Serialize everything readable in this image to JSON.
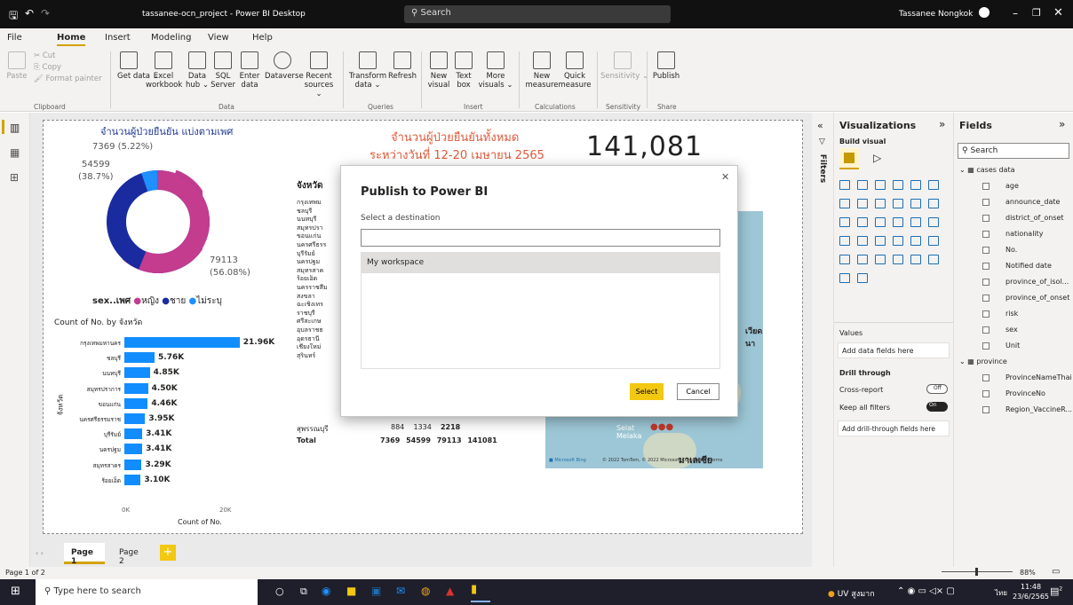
{
  "window": {
    "title": "tassanee-ocn_project - Power BI Desktop",
    "search": "Search",
    "user": "Tassanee Nongkok"
  },
  "tabs": [
    "File",
    "Home",
    "Insert",
    "Modeling",
    "View",
    "Help"
  ],
  "ribbon": {
    "clipboard": {
      "paste": "Paste",
      "cut": "Cut",
      "copy": "Copy",
      "format_painter": "Format painter",
      "group": "Clipboard"
    },
    "data": {
      "items": [
        "Get data ⌄",
        "Excel workbook",
        "Data hub ⌄",
        "SQL Server",
        "Enter data",
        "Dataverse",
        "Recent sources ⌄"
      ],
      "group": "Data"
    },
    "queries": {
      "items": [
        "Transform data ⌄",
        "Refresh"
      ],
      "group": "Queries"
    },
    "insert": {
      "items": [
        "New visual",
        "Text box",
        "More visuals ⌄"
      ],
      "group": "Insert"
    },
    "calculations": {
      "items": [
        "New measure",
        "Quick measure"
      ],
      "group": "Calculations"
    },
    "sensitivity": {
      "items": [
        "Sensitivity ⌄"
      ],
      "group": "Sensitivity"
    },
    "share": {
      "items": [
        "Publish"
      ],
      "group": "Share"
    }
  },
  "report": {
    "donut_title": "จำนวนผู้ป่วยยืนยัน แบ่งตามเพศ",
    "donut_labels": {
      "a": "7369 (5.22%)",
      "b1": "54599",
      "b2": "(38.7%)",
      "c1": "79113",
      "c2": "(56.08%)"
    },
    "donut_legend": {
      "title": "sex..เพศ",
      "items": [
        "หญิง",
        "ชาย",
        "ไม่ระบุ"
      ]
    },
    "headline1": "จำนวนผู้ป่วยยืนยันทั้งหมด",
    "headline2": "ระหว่างวันที่ 12-20 เมษายน 2565",
    "kpi": "141,081",
    "bar_title": "Count of No. by จังหวัด",
    "bar_ylabel": "จังหวัด",
    "bar_xlabel": "Count of No.",
    "bar_ticks": [
      "0K",
      "20K"
    ],
    "table_header": "จังหวัด",
    "table_rows": [
      "กรุงเทพม",
      "ชลบุรี",
      "นนทบุรี",
      "สมุทรปรา",
      "ขอนแก่น",
      "นครศรีธรร",
      "บุรีรัมย์",
      "นครปฐม",
      "สมุทรสาค",
      "ร้อยเอ็ด",
      "นครราชสีม",
      "สงขลา",
      "ฉะเชิงเทร",
      "ราชบุรี",
      "ศรีสะเกษ",
      "อุบลราชธ",
      "อุดรธานี",
      "เชียงใหม่",
      "สุรินทร์",
      "ระยอง",
      "สุพรรณบุรี"
    ],
    "table_last": [
      "884",
      "1334",
      "2218"
    ],
    "table_total": {
      "label": "Total",
      "values": [
        "7369",
        "54599",
        "79113",
        "141081"
      ]
    },
    "map_labels": [
      "เวียดนา",
      "Selat Melaka",
      "มาเลเซีย"
    ],
    "map_credit": "© 2022 TomTom, © 2022 Microsoft Corporation  Terms"
  },
  "chart_data": {
    "type": "bar",
    "title": "Count of No. by จังหวัด",
    "xlabel": "Count of No.",
    "ylabel": "จังหวัด",
    "categories": [
      "กรุงเทพมหานคร",
      "ชลบุรี",
      "นนทบุรี",
      "สมุทรปราการ",
      "ขอนแก่น",
      "นครศรีธรรมราช",
      "บุรีรัมย์",
      "นครปฐม",
      "สมุทรสาคร",
      "ร้อยเอ็ด"
    ],
    "values": [
      21960,
      5760,
      4850,
      4500,
      4460,
      3950,
      3410,
      3410,
      3290,
      3100
    ],
    "value_labels": [
      "21.96K",
      "5.76K",
      "4.85K",
      "4.50K",
      "4.46K",
      "3.95K",
      "3.41K",
      "3.41K",
      "3.29K",
      "3.10K"
    ],
    "xlim": [
      0,
      24000
    ]
  },
  "dialog": {
    "title": "Publish to Power BI",
    "subtitle": "Select a destination",
    "search_value": "",
    "workspace": "My workspace",
    "select": "Select",
    "cancel": "Cancel"
  },
  "filters": {
    "label": "Filters"
  },
  "visualizations": {
    "title": "Visualizations",
    "build": "Build visual",
    "values": "Values",
    "add_fields": "Add data fields here",
    "drill": "Drill through",
    "cross": "Cross-report",
    "cross_state": "Off",
    "keep": "Keep all filters",
    "keep_state": "On",
    "add_drill": "Add drill-through fields here"
  },
  "fields": {
    "title": "Fields",
    "search": "Search",
    "tables": [
      {
        "name": "cases data",
        "items": [
          "age",
          "announce_date",
          "district_of_onset",
          "nationality",
          "No.",
          "Notified date",
          "province_of_isol...",
          "province_of_onset",
          "risk",
          "sex",
          "Unit"
        ]
      },
      {
        "name": "province",
        "items": [
          "ProvinceNameThai",
          "ProvinceNo",
          "Region_VaccineR..."
        ]
      }
    ]
  },
  "pages": {
    "items": [
      "Page 1",
      "Page 2"
    ],
    "add": "+"
  },
  "status": {
    "page": "Page 1 of 2",
    "zoom": "88%"
  },
  "taskbar": {
    "search": "Type here to search",
    "weather": "UV สูงมาก",
    "lang": "ไทย",
    "time": "11:48",
    "date": "23/6/2565",
    "badge": "2"
  }
}
